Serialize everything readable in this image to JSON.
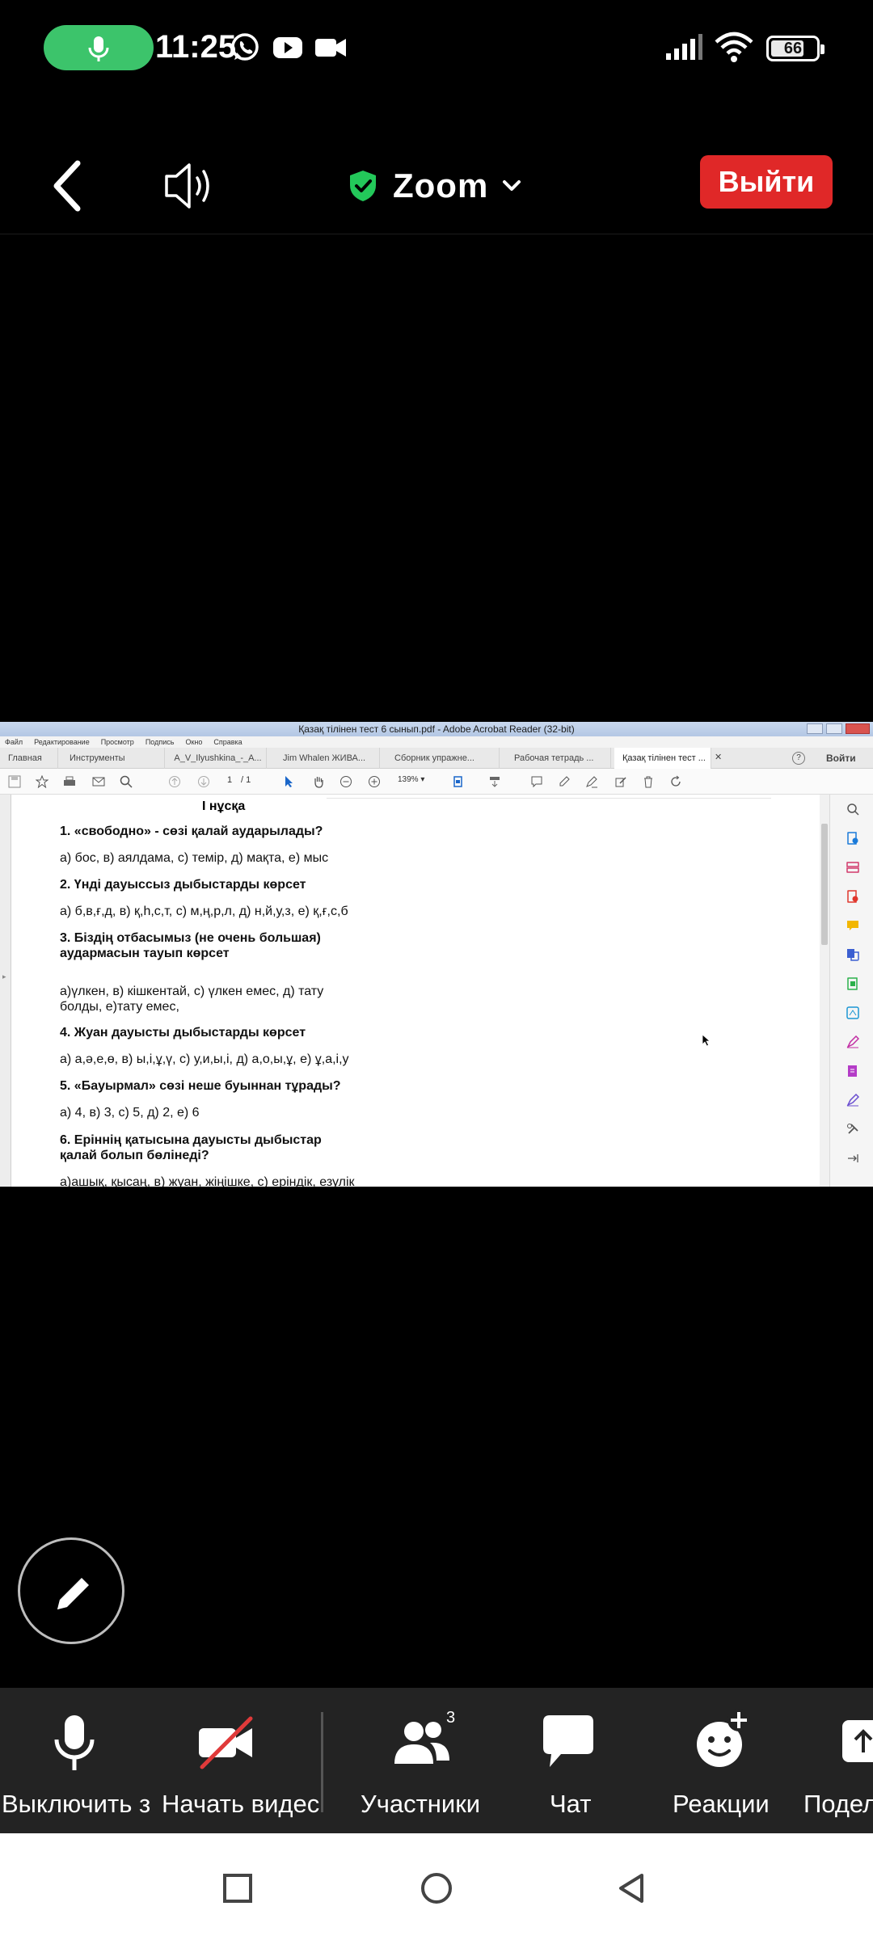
{
  "status_bar": {
    "time": "11:25",
    "battery_level": "66",
    "battery_fraction": 0.66
  },
  "zoom_header": {
    "meeting_title": "Zoom",
    "exit_label": "Выйти"
  },
  "acrobat": {
    "window_title": "Қазақ тілінен тест 6 сынып.pdf - Adobe Acrobat Reader (32-bit)",
    "menu": [
      "Файл",
      "Редактирование",
      "Просмотр",
      "Подпись",
      "Окно",
      "Справка"
    ],
    "tabs": [
      "Главная",
      "Инструменты",
      "A_V_Ilyushkina_-_A...",
      "Jim Whalen ЖИВА...",
      "Сборник упражне...",
      "Рабочая тетрадь ...",
      "Қазақ тілінен тест ..."
    ],
    "sign_in": "Войти",
    "page_current": "1",
    "page_total": "/ 1",
    "zoom": "139%",
    "document": {
      "variant": "І нұсқа",
      "lines": [
        {
          "bold": true,
          "text": "1. «свободно» - сөзі қалай аударылады?"
        },
        {
          "bold": false,
          "text": "а) бос, в) аялдама, с) темір, д) мақта, е) мыс"
        },
        {
          "bold": true,
          "text": "2. Үнді дауыссыз дыбыстарды көрсет"
        },
        {
          "bold": false,
          "text": "а) б,в,ғ,д, в) қ,һ,с,т, с) м,ң,р,л, д) н,й,у,з, е) қ,ғ,с,б"
        },
        {
          "bold": true,
          "text": "3. Біздің отбасымыз (не очень большая)"
        },
        {
          "bold": true,
          "text": "аудармасын тауып көрсет"
        },
        {
          "bold": false,
          "text": "а)үлкен, в) кішкентай, с) үлкен емес, д) тату"
        },
        {
          "bold": false,
          "text": "болды, е)тату емес,"
        },
        {
          "bold": true,
          "text": "4. Жуан дауысты дыбыстарды көрсет"
        },
        {
          "bold": false,
          "text": "а) а,ә,е,ө, в) ы,і,ұ,ү, с) у,и,ы,і, д) а,о,ы,ұ, е) ұ,а,і,у"
        },
        {
          "bold": true,
          "text": "5. «Бауырмал» сөзі неше буыннан тұрады?"
        },
        {
          "bold": false,
          "text": "а) 4, в) 3, с) 5, д) 2, е) 6"
        },
        {
          "bold": true,
          "text": "6. Еріннің қатысына дауысты дыбыстар"
        },
        {
          "bold": true,
          "text": "қалай болып бөлінеді?"
        },
        {
          "bold": false,
          "text": "а)ашық, қысаң, в) жуан, жіңішке, с) еріндік, езулік"
        }
      ]
    }
  },
  "bottom_bar": {
    "mute_label": "Выключить з",
    "video_label": "Начать видес",
    "participants_label": "Участники",
    "participants_count": "3",
    "chat_label": "Чат",
    "reactions_label": "Реакции",
    "share_label": "Подел"
  },
  "icons": {
    "mic": "mic-icon",
    "whatsapp": "whatsapp-icon",
    "youtube": "youtube-icon",
    "video": "video-camera-icon",
    "signal": "signal-icon",
    "wifi": "wifi-icon",
    "back": "chevron-left-icon",
    "speaker": "speaker-icon",
    "shield": "shield-check-icon",
    "edit": "pencil-icon"
  },
  "colors": {
    "exit_red": "#e02828",
    "mic_green": "#3cc46b",
    "shield_green": "#23c85a",
    "bottom_bar": "#232323"
  }
}
